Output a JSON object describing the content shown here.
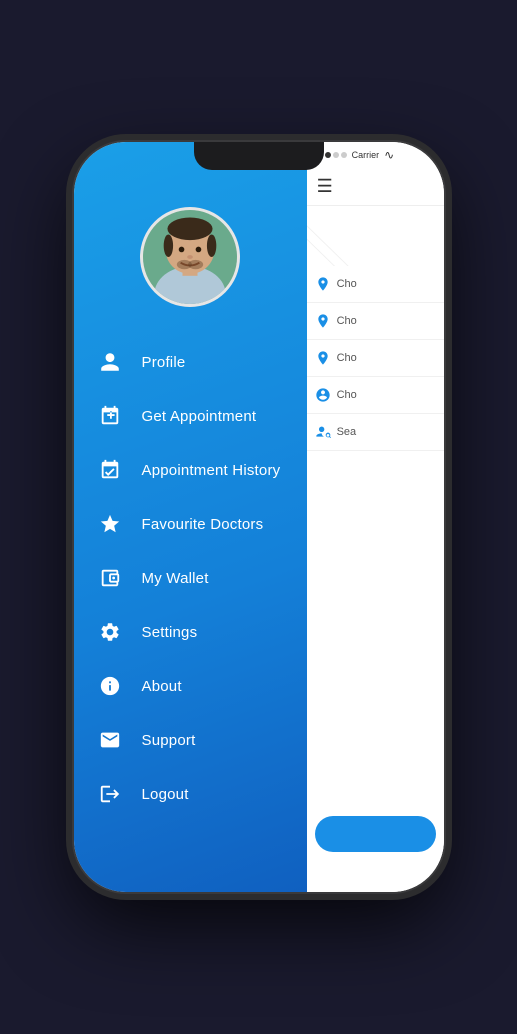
{
  "phone": {
    "status_bar": {
      "dots": [
        "filled",
        "filled",
        "empty",
        "empty"
      ],
      "carrier": "Carrier",
      "wifi": "wifi"
    },
    "drawer": {
      "menu_items": [
        {
          "id": "profile",
          "label": "Profile",
          "icon": "person"
        },
        {
          "id": "get-appointment",
          "label": "Get Appointment",
          "icon": "calendar-plus"
        },
        {
          "id": "appointment-history",
          "label": "Appointment History",
          "icon": "calendar-check"
        },
        {
          "id": "favourite-doctors",
          "label": "Favourite Doctors",
          "icon": "star"
        },
        {
          "id": "my-wallet",
          "label": "My Wallet",
          "icon": "wallet"
        },
        {
          "id": "settings",
          "label": "Settings",
          "icon": "gear"
        },
        {
          "id": "about",
          "label": "About",
          "icon": "info"
        },
        {
          "id": "support",
          "label": "Support",
          "icon": "envelope"
        },
        {
          "id": "logout",
          "label": "Logout",
          "icon": "logout"
        }
      ]
    },
    "main": {
      "hamburger_label": "☰",
      "choice_items": [
        {
          "id": "c1",
          "text": "Cho",
          "icon": "location-person"
        },
        {
          "id": "c2",
          "text": "Cho",
          "icon": "pin"
        },
        {
          "id": "c3",
          "text": "Cho",
          "icon": "pin"
        },
        {
          "id": "c4",
          "text": "Cho",
          "icon": "person-circle"
        },
        {
          "id": "c5",
          "text": "Sea",
          "icon": "person-search"
        }
      ]
    }
  }
}
